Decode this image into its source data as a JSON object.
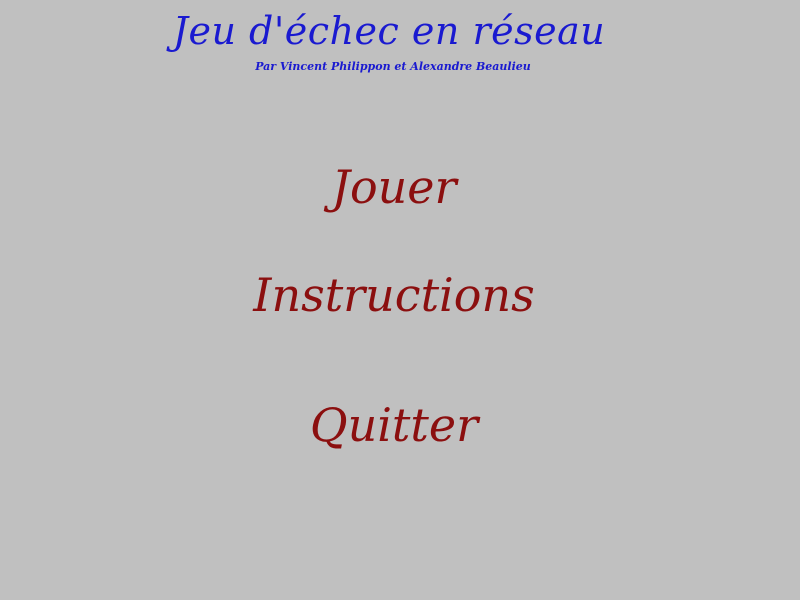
{
  "header": {
    "title": "Jeu d'échec en réseau",
    "subtitle": "Par Vincent Philippon et Alexandre Beaulieu"
  },
  "menu": {
    "play": "Jouer",
    "instructions": "Instructions",
    "quit": "Quitter"
  },
  "colors": {
    "background": "#c0c0c0",
    "title": "#1a1ad0",
    "subtitle": "#1a1ad0",
    "menu_text": "#8b0f0f"
  }
}
